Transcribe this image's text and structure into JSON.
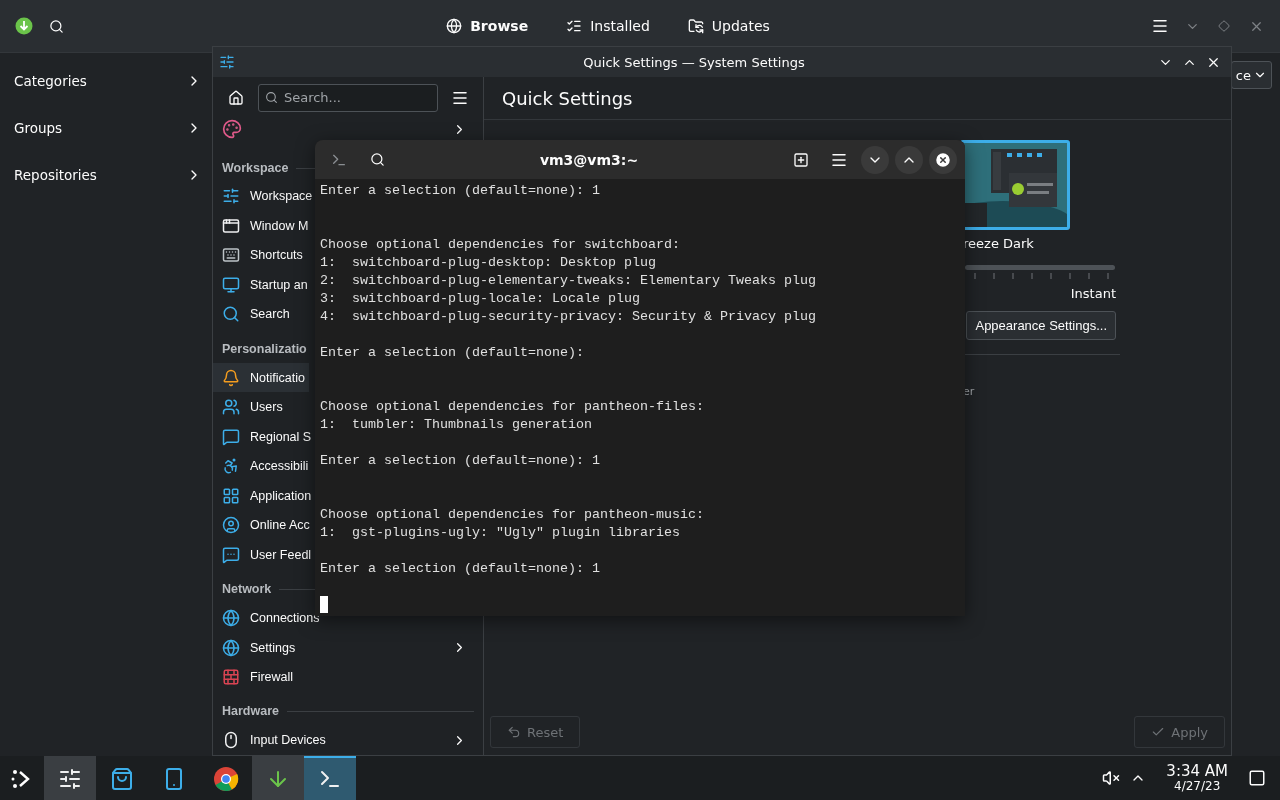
{
  "discover": {
    "tabs": [
      {
        "label": "Browse",
        "selected": true
      },
      {
        "label": "Installed",
        "selected": false
      },
      {
        "label": "Updates",
        "selected": false
      }
    ],
    "sidebar": [
      {
        "label": "Categories"
      },
      {
        "label": "Groups"
      },
      {
        "label": "Repositories"
      }
    ],
    "dropdown": {
      "value": "ce"
    }
  },
  "settings": {
    "title": "Quick Settings — System Settings",
    "search": {
      "placeholder": "Search..."
    },
    "top_item": {
      "has_children": true
    },
    "sections": [
      {
        "heading": "Workspace",
        "items": [
          {
            "label": "Workspace",
            "has_children": false,
            "hovered": false
          },
          {
            "label": "Window M",
            "has_children": false,
            "hovered": false
          },
          {
            "label": "Shortcuts",
            "has_children": false,
            "hovered": false
          },
          {
            "label": "Startup an",
            "has_children": false,
            "hovered": false
          },
          {
            "label": "Search",
            "has_children": false,
            "hovered": false
          }
        ]
      },
      {
        "heading": "Personalizatio",
        "items": [
          {
            "label": "Notificatio",
            "has_children": false,
            "hovered": true
          },
          {
            "label": "Users",
            "has_children": false,
            "hovered": false
          },
          {
            "label": "Regional S",
            "has_children": false,
            "hovered": false
          },
          {
            "label": "Accessibili",
            "has_children": false,
            "hovered": false
          },
          {
            "label": "Application",
            "has_children": false,
            "hovered": false
          },
          {
            "label": "Online Acc",
            "has_children": false,
            "hovered": false
          },
          {
            "label": "User Feedl",
            "has_children": false,
            "hovered": false
          }
        ]
      },
      {
        "heading": "Network",
        "items": [
          {
            "label": "Connections",
            "has_children": false,
            "hovered": false
          },
          {
            "label": "Settings",
            "has_children": true,
            "hovered": false
          },
          {
            "label": "Firewall",
            "has_children": false,
            "hovered": false
          }
        ]
      },
      {
        "heading": "Hardware",
        "items": [
          {
            "label": "Input Devices",
            "has_children": true,
            "hovered": false
          }
        ]
      }
    ],
    "page_title": "Quick Settings",
    "theme": {
      "label": "reeze Dark",
      "selected": true
    },
    "slider_label": "Instant",
    "appearance_button": "Appearance Settings...",
    "partial_label": "er",
    "buttons": [
      {
        "kind": "reset",
        "label": "Reset",
        "disabled": true
      },
      {
        "kind": "apply",
        "label": "Apply",
        "disabled": true
      }
    ]
  },
  "terminal": {
    "title": "vm3@vm3:~",
    "blocks": [
      {
        "kind": "prompt",
        "lines": [
          "Enter a selection (default=none): 1"
        ]
      },
      {
        "kind": "choices",
        "lines": [
          "Choose optional dependencies for switchboard:",
          "1:  switchboard-plug-desktop: Desktop plug",
          "2:  switchboard-plug-elementary-tweaks: Elementary Tweaks plug",
          "3:  switchboard-plug-locale: Locale plug",
          "4:  switchboard-plug-security-privacy: Security & Privacy plug"
        ]
      },
      {
        "kind": "prompt",
        "lines": [
          "Enter a selection (default=none):"
        ]
      },
      {
        "kind": "choices",
        "lines": [
          "Choose optional dependencies for pantheon-files:",
          "1:  tumbler: Thumbnails generation"
        ]
      },
      {
        "kind": "prompt",
        "lines": [
          "Enter a selection (default=none): 1"
        ]
      },
      {
        "kind": "choices",
        "lines": [
          "Choose optional dependencies for pantheon-music:",
          "1:  gst-plugins-ugly: \"Ugly\" plugin libraries"
        ]
      },
      {
        "kind": "prompt",
        "lines": [
          "Enter a selection (default=none): 1"
        ]
      }
    ]
  },
  "taskbar": {
    "apps": [
      {
        "open": true,
        "focused": false
      },
      {
        "open": false,
        "focused": false
      },
      {
        "open": false,
        "focused": false
      },
      {
        "open": false,
        "focused": false
      },
      {
        "open": true,
        "focused": false
      },
      {
        "open": true,
        "focused": true
      }
    ],
    "muted": true,
    "clock": {
      "time": "3:34 AM",
      "date": "4/27/23"
    }
  }
}
